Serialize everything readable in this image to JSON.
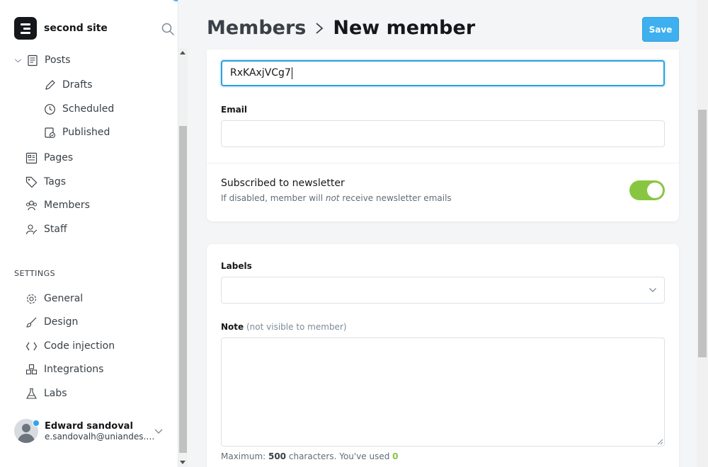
{
  "brand": {
    "name": "second site"
  },
  "nav": {
    "posts": "Posts",
    "drafts": "Drafts",
    "scheduled": "Scheduled",
    "published": "Published",
    "pages": "Pages",
    "tags": "Tags",
    "members": "Members",
    "staff": "Staff"
  },
  "settings": {
    "label": "SETTINGS",
    "general": "General",
    "design": "Design",
    "code_injection": "Code injection",
    "integrations": "Integrations",
    "labs": "Labs"
  },
  "user": {
    "name": "Edward sandoval",
    "email": "e.sandovalh@uniandes.edu.co"
  },
  "header": {
    "crumb_parent": "Members",
    "crumb_current": "New member",
    "save_label": "Save"
  },
  "form": {
    "name_value": "RxKAxjVCg7",
    "email_label": "Email",
    "email_value": "",
    "newsletter_title": "Subscribed to newsletter",
    "newsletter_desc_before": "If disabled, member will ",
    "newsletter_desc_em": "not",
    "newsletter_desc_after": " receive newsletter emails",
    "newsletter_enabled": true,
    "labels_label": "Labels",
    "note_label": "Note",
    "note_hint": "(not visible to member)",
    "note_value": "",
    "max_prefix": "Maximum: ",
    "max_chars": "500",
    "max_middle": " characters. You've used ",
    "used_chars": "0"
  },
  "colors": {
    "accent": "#3eb0ef",
    "toggle_on": "#88c641"
  }
}
